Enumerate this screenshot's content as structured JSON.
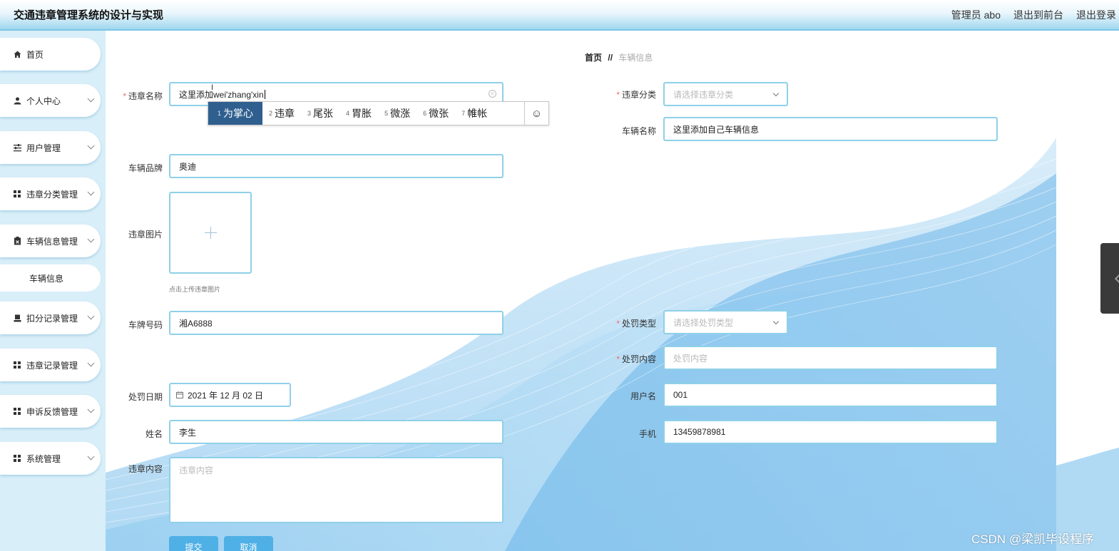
{
  "header": {
    "title": "交通违章管理系统的设计与实现",
    "admin_label": "管理员 abo",
    "to_front": "退出到前台",
    "logout": "退出登录"
  },
  "sidebar": {
    "items": [
      {
        "label": "首页",
        "icon": "home-icon"
      },
      {
        "label": "个人中心",
        "icon": "user-icon"
      },
      {
        "label": "用户管理",
        "icon": "sliders-icon"
      },
      {
        "label": "违章分类管理",
        "icon": "grid-icon"
      },
      {
        "label": "车辆信息管理",
        "icon": "clipboard-icon"
      },
      {
        "label": "扣分记录管理",
        "icon": "stamp-icon"
      },
      {
        "label": "违章记录管理",
        "icon": "grid-icon"
      },
      {
        "label": "申诉反馈管理",
        "icon": "grid-icon"
      },
      {
        "label": "系统管理",
        "icon": "grid-icon"
      }
    ],
    "subitem": "车辆信息"
  },
  "breadcrumb": {
    "home": "首页",
    "separator": "//",
    "current": "车辆信息"
  },
  "form": {
    "violation_name": {
      "label": "违章名称",
      "value": "这里添加wei'zhang'xin"
    },
    "violation_category": {
      "label": "违章分类",
      "placeholder": "请选择违章分类"
    },
    "vehicle_name": {
      "label": "车辆名称",
      "value": "这里添加自己车辆信息"
    },
    "vehicle_brand": {
      "label": "车辆品牌",
      "value": "奥迪"
    },
    "violation_image": {
      "label": "违章图片",
      "tip": "点击上传违章图片"
    },
    "plate_number": {
      "label": "车牌号码",
      "value": "湘A6888"
    },
    "penalty_type": {
      "label": "处罚类型",
      "placeholder": "请选择处罚类型"
    },
    "penalty_content": {
      "label": "处罚内容",
      "placeholder": "处罚内容"
    },
    "penalty_date": {
      "label": "处罚日期",
      "value": "2021 年 12 月 02 日"
    },
    "username": {
      "label": "用户名",
      "value": "001"
    },
    "name": {
      "label": "姓名",
      "value": "李生"
    },
    "phone": {
      "label": "手机",
      "value": "13459878981"
    },
    "violation_content": {
      "label": "违章内容",
      "placeholder": "违章内容"
    },
    "submit": "提交",
    "cancel": "取消"
  },
  "ime": {
    "candidates": [
      {
        "n": "1",
        "text": "为掌心"
      },
      {
        "n": "2",
        "text": "违章"
      },
      {
        "n": "3",
        "text": "尾张"
      },
      {
        "n": "4",
        "text": "胃胀"
      },
      {
        "n": "5",
        "text": "微涨"
      },
      {
        "n": "6",
        "text": "微张"
      },
      {
        "n": "7",
        "text": "帷帐"
      }
    ]
  },
  "watermark": "CSDN @梁凯毕设程序",
  "colors": {
    "accent": "#4fb0e6",
    "border": "#8fd0e8",
    "sidebar_bg": "#d8eef8",
    "ime_active": "#2f5f8f",
    "required": "#f56c6c"
  }
}
